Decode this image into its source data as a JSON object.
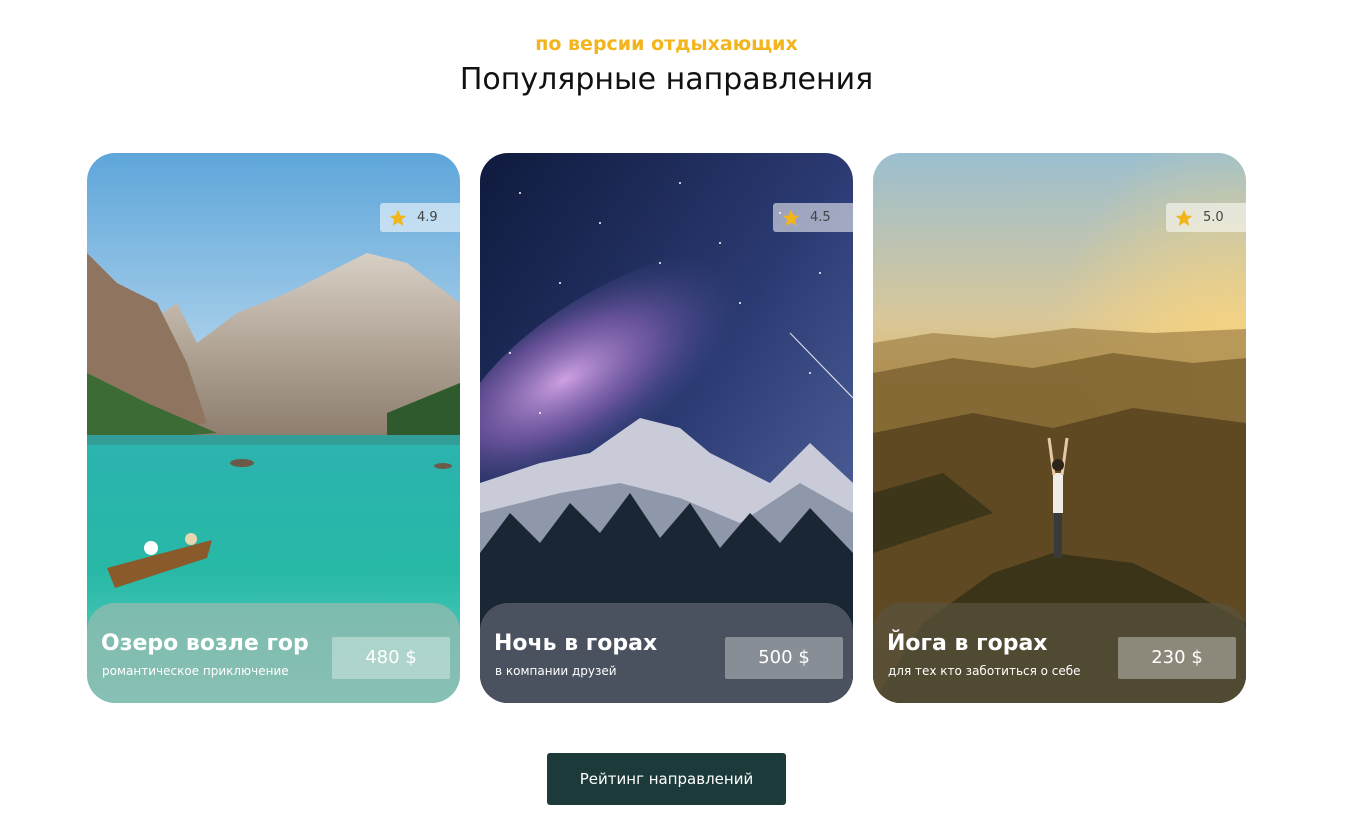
{
  "header": {
    "subtitle": "по версии отдыхающих",
    "title": "Популярные направления"
  },
  "cards": [
    {
      "name": "Озеро возле гор",
      "description": "романтическое приключение",
      "price": "480 $",
      "rating": "4.9",
      "image_icon": "mountain-lake-image"
    },
    {
      "name": "Ночь в горах",
      "description": "в компании друзей",
      "price": "500 $",
      "rating": "4.5",
      "image_icon": "night-mountains-image"
    },
    {
      "name": "Йога в горах",
      "description": "для тех кто заботиться о себе",
      "price": "230 $",
      "rating": "5.0",
      "image_icon": "yoga-sunset-image"
    }
  ],
  "cta": {
    "label": "Рейтинг направлений"
  },
  "colors": {
    "accent": "#f2b51c",
    "button": "#1c3a3a",
    "star": "#f2b51c"
  }
}
